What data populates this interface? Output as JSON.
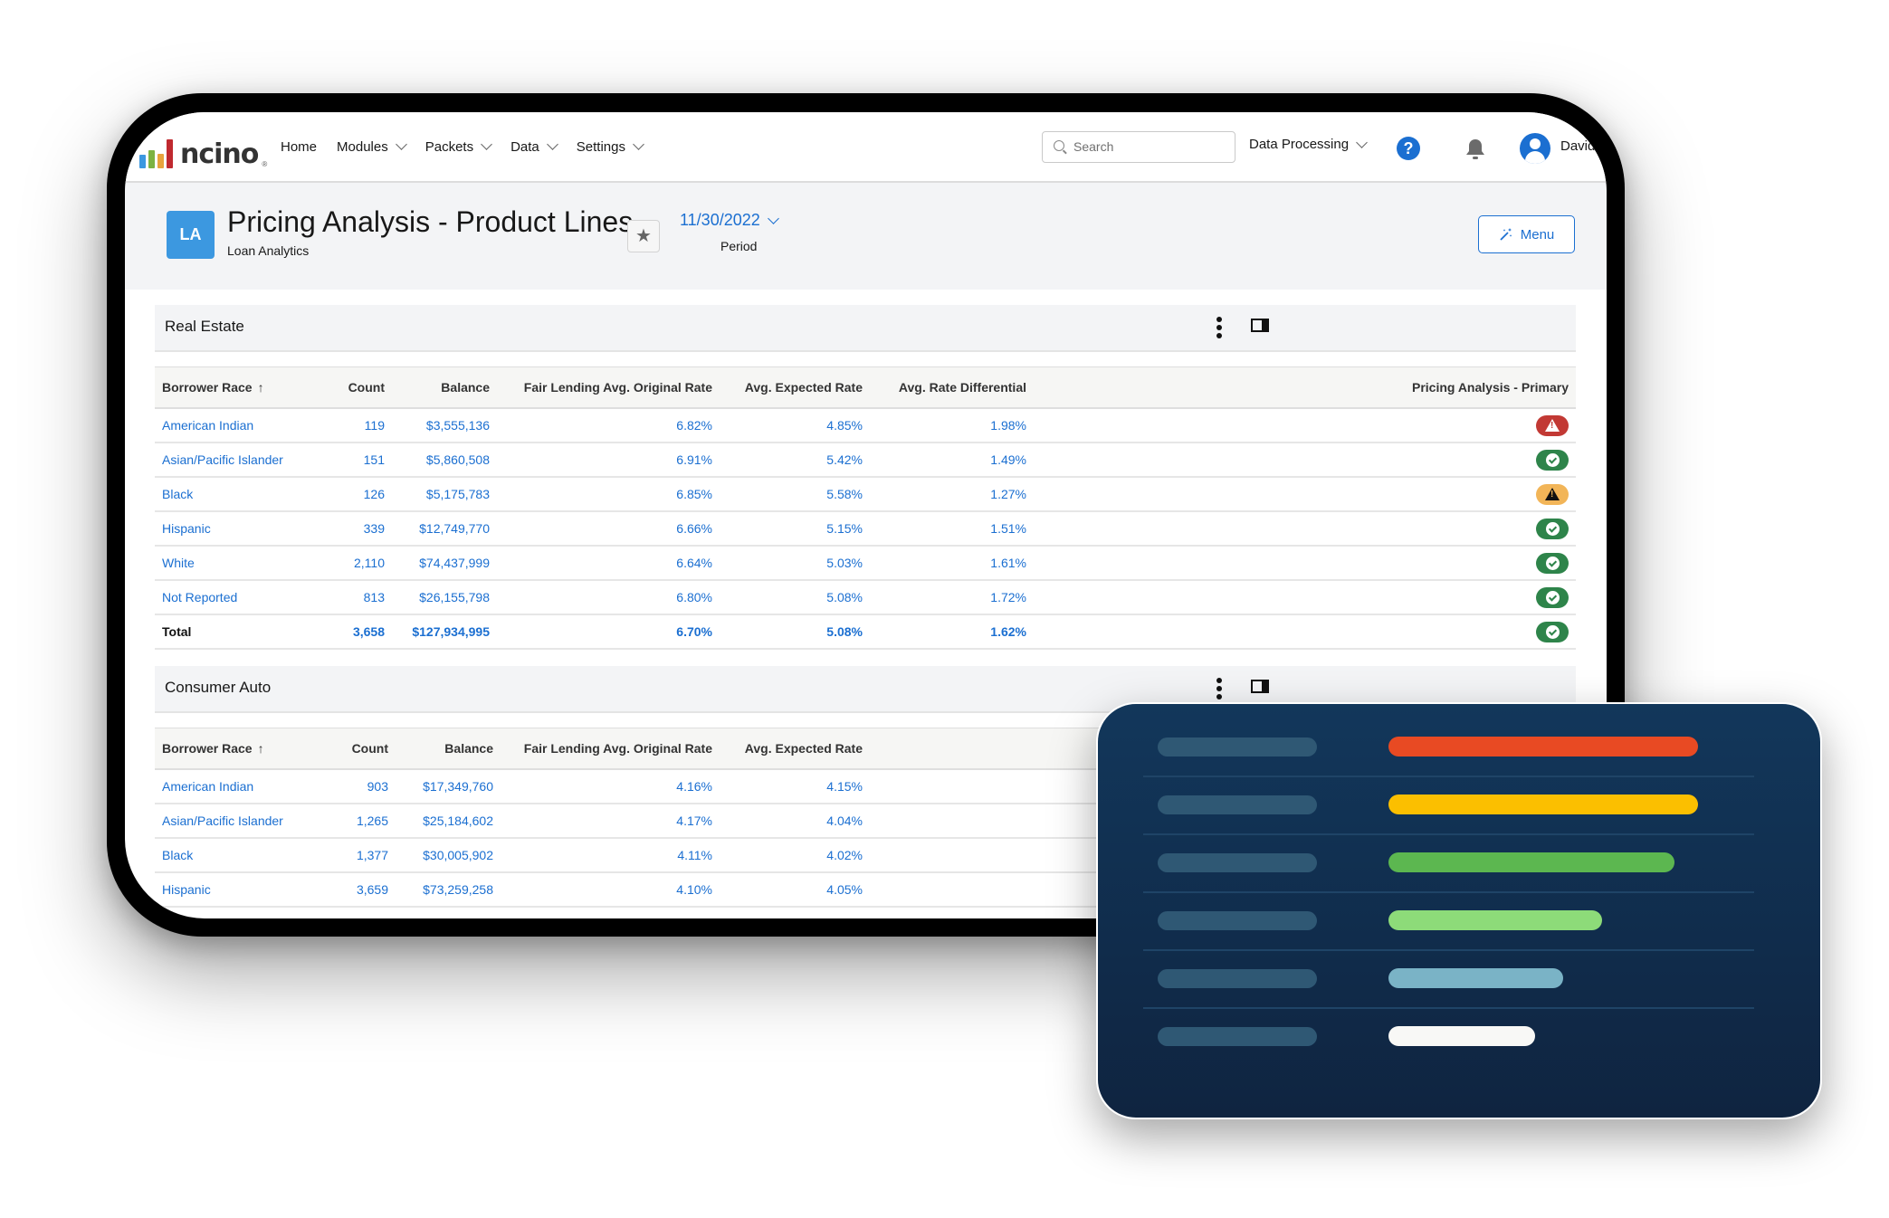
{
  "nav": {
    "brand": "ncino",
    "items": [
      {
        "label": "Home",
        "dropdown": false
      },
      {
        "label": "Modules",
        "dropdown": true
      },
      {
        "label": "Packets",
        "dropdown": true
      },
      {
        "label": "Data",
        "dropdown": true
      },
      {
        "label": "Settings",
        "dropdown": true
      }
    ],
    "search_placeholder": "Search",
    "workspace": "Data Processing",
    "help_icon": "?",
    "user": "David"
  },
  "header": {
    "app_icon": "LA",
    "title": "Pricing Analysis - Product Lines",
    "subtitle": "Loan Analytics",
    "favorite_icon": "★",
    "period_value": "11/30/2022",
    "period_label": "Period",
    "menu_label": "Menu"
  },
  "colors": {
    "accent": "#1b6fd1",
    "status_ok": "#2e844a",
    "status_error": "#c23934",
    "status_warning": "#f2b558"
  },
  "sections": [
    {
      "title": "Real Estate",
      "columns": [
        "Borrower Race",
        "Count",
        "Balance",
        "Fair Lending Avg. Original Rate",
        "Avg. Expected Rate",
        "Avg. Rate Differential",
        "Pricing Analysis - Primary"
      ],
      "rows": [
        {
          "race": "American Indian",
          "count": "119",
          "balance": "$3,555,136",
          "orig_rate": "6.82%",
          "exp_rate": "4.85%",
          "diff": "1.98%",
          "status": "error"
        },
        {
          "race": "Asian/Pacific Islander",
          "count": "151",
          "balance": "$5,860,508",
          "orig_rate": "6.91%",
          "exp_rate": "5.42%",
          "diff": "1.49%",
          "status": "ok"
        },
        {
          "race": "Black",
          "count": "126",
          "balance": "$5,175,783",
          "orig_rate": "6.85%",
          "exp_rate": "5.58%",
          "diff": "1.27%",
          "status": "warning"
        },
        {
          "race": "Hispanic",
          "count": "339",
          "balance": "$12,749,770",
          "orig_rate": "6.66%",
          "exp_rate": "5.15%",
          "diff": "1.51%",
          "status": "ok"
        },
        {
          "race": "White",
          "count": "2,110",
          "balance": "$74,437,999",
          "orig_rate": "6.64%",
          "exp_rate": "5.03%",
          "diff": "1.61%",
          "status": "ok"
        },
        {
          "race": "Not Reported",
          "count": "813",
          "balance": "$26,155,798",
          "orig_rate": "6.80%",
          "exp_rate": "5.08%",
          "diff": "1.72%",
          "status": "ok"
        }
      ],
      "total": {
        "race": "Total",
        "count": "3,658",
        "balance": "$127,934,995",
        "orig_rate": "6.70%",
        "exp_rate": "5.08%",
        "diff": "1.62%",
        "status": "ok"
      }
    },
    {
      "title": "Consumer Auto",
      "columns": [
        "Borrower Race",
        "Count",
        "Balance",
        "Fair Lending Avg. Original Rate",
        "Avg. Expected Rate"
      ],
      "rows": [
        {
          "race": "American Indian",
          "count": "903",
          "balance": "$17,349,760",
          "orig_rate": "4.16%",
          "exp_rate": "4.15%"
        },
        {
          "race": "Asian/Pacific Islander",
          "count": "1,265",
          "balance": "$25,184,602",
          "orig_rate": "4.17%",
          "exp_rate": "4.04%"
        },
        {
          "race": "Black",
          "count": "1,377",
          "balance": "$30,005,902",
          "orig_rate": "4.11%",
          "exp_rate": "4.02%"
        },
        {
          "race": "Hispanic",
          "count": "3,659",
          "balance": "$73,259,258",
          "orig_rate": "4.10%",
          "exp_rate": "4.05%"
        }
      ]
    }
  ],
  "overlay_card": {
    "bars": [
      {
        "fraction": 1.0,
        "color": "#e84a23"
      },
      {
        "fraction": 1.0,
        "color": "#fbbf00"
      },
      {
        "fraction": 0.925,
        "color": "#5cb750"
      },
      {
        "fraction": 0.69,
        "color": "#8ddb79"
      },
      {
        "fraction": 0.565,
        "color": "#7ab3c6"
      },
      {
        "fraction": 0.475,
        "color": "#f8f8f6"
      }
    ]
  }
}
